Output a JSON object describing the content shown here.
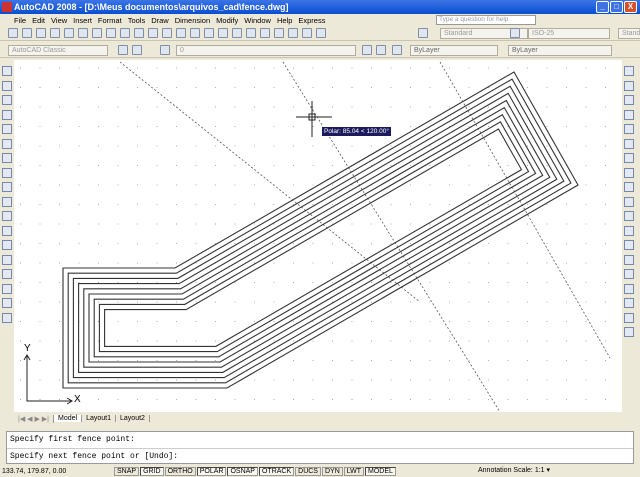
{
  "window": {
    "title": "AutoCAD 2008 - [D:\\Meus documentos\\arquivos_cad\\fence.dwg]",
    "minimize": "_",
    "maximize": "□",
    "close": "X"
  },
  "menu": [
    "File",
    "Edit",
    "View",
    "Insert",
    "Format",
    "Tools",
    "Draw",
    "Dimension",
    "Modify",
    "Window",
    "Help",
    "Express"
  ],
  "help": {
    "placeholder": "Type a question for help"
  },
  "toolbars": {
    "text_style": "Standard",
    "dim_style": "ISO-25",
    "table_style": "Standard",
    "workspace": "AutoCAD Classic",
    "layer": "0",
    "color": "ByLayer",
    "linetype": "ByLayer",
    "lineweight": "ByLayer"
  },
  "canvas": {
    "tooltip": "Polar: 85.04 < 120.00°",
    "ucs_x": "X",
    "ucs_y": "Y"
  },
  "tabs": [
    "Model",
    "Layout1",
    "Layout2"
  ],
  "command": {
    "lines": [
      "Specify first fence point:",
      "Specify next fence point or [Undo]:"
    ]
  },
  "status": {
    "coords": "133.74, 179.87, 0.00",
    "buttons": [
      {
        "label": "SNAP",
        "on": false
      },
      {
        "label": "GRID",
        "on": true
      },
      {
        "label": "ORTHO",
        "on": false
      },
      {
        "label": "POLAR",
        "on": true
      },
      {
        "label": "OSNAP",
        "on": true
      },
      {
        "label": "OTRACK",
        "on": true
      },
      {
        "label": "DUCS",
        "on": false
      },
      {
        "label": "DYN",
        "on": false
      },
      {
        "label": "LWT",
        "on": false
      },
      {
        "label": "MODEL",
        "on": true
      }
    ],
    "annotation_scale_label": "Annotation Scale:",
    "annotation_scale": "1:1 ▾"
  }
}
